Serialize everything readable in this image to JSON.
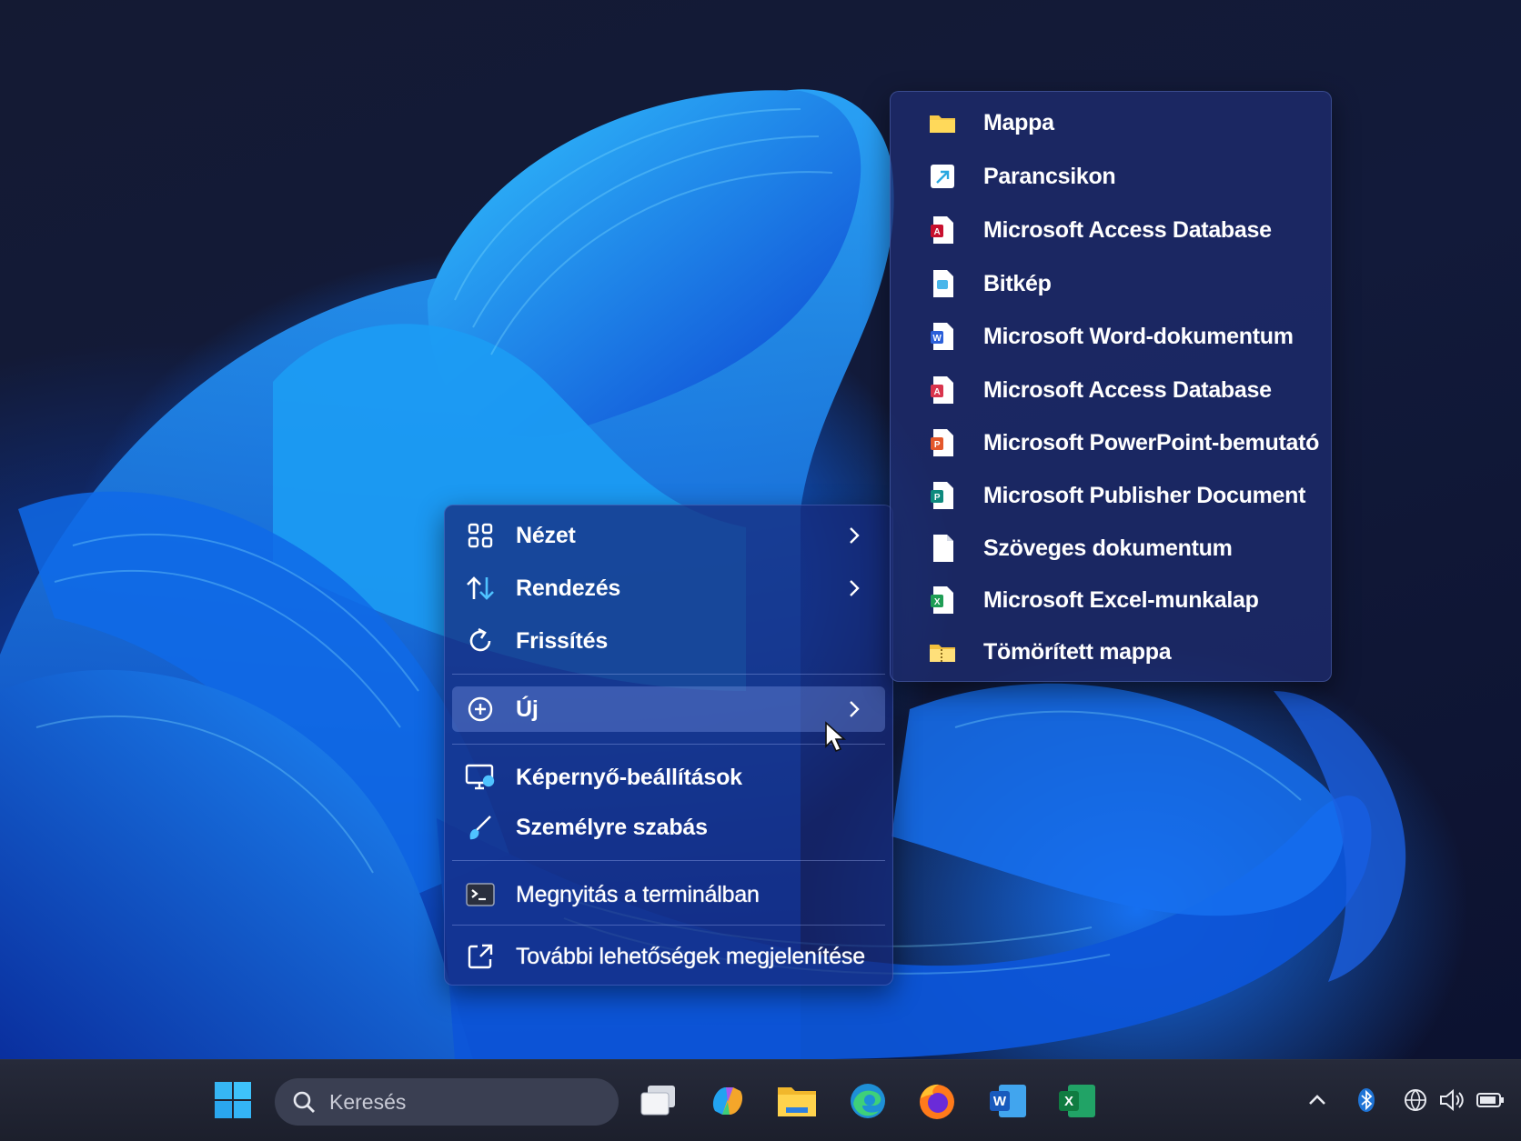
{
  "context_menu": {
    "items": [
      {
        "label": "Nézet",
        "icon": "grid-icon",
        "has_submenu": true
      },
      {
        "label": "Rendezés",
        "icon": "sort-arrows-icon",
        "has_submenu": true
      },
      {
        "label": "Frissítés",
        "icon": "refresh-icon",
        "has_submenu": false
      },
      {
        "label": "Új",
        "icon": "new-plus-icon",
        "has_submenu": true,
        "highlighted": true
      },
      {
        "label": "Képernyő-beállítások",
        "icon": "display-settings-icon"
      },
      {
        "label": "Személyre szabás",
        "icon": "brush-icon"
      },
      {
        "label": "Megnyitás a terminálban",
        "icon": "terminal-icon"
      },
      {
        "label": "További lehetőségek megjelenítése",
        "icon": "more-options-icon"
      }
    ]
  },
  "new_submenu": {
    "items": [
      {
        "label": "Mappa",
        "icon": "folder-icon"
      },
      {
        "label": "Parancsikon",
        "icon": "shortcut-icon"
      },
      {
        "label": "Microsoft Access Database",
        "icon": "access-file-icon"
      },
      {
        "label": "Bitkép",
        "icon": "bitmap-file-icon"
      },
      {
        "label": "Microsoft Word-dokumentum",
        "icon": "word-file-icon"
      },
      {
        "label": "Microsoft Access Database",
        "icon": "access-file-icon"
      },
      {
        "label": "Microsoft PowerPoint-bemutató",
        "icon": "powerpoint-file-icon"
      },
      {
        "label": "Microsoft Publisher Document",
        "icon": "publisher-file-icon"
      },
      {
        "label": "Szöveges dokumentum",
        "icon": "text-file-icon"
      },
      {
        "label": "Microsoft Excel-munkalap",
        "icon": "excel-file-icon"
      },
      {
        "label": "Tömörített mappa",
        "icon": "zip-folder-icon"
      }
    ]
  },
  "taskbar": {
    "search_placeholder": "Keresés",
    "apps": [
      "task-view-icon",
      "copilot-icon",
      "file-explorer-icon",
      "edge-icon",
      "firefox-icon",
      "word-icon",
      "excel-icon"
    ],
    "tray": [
      "chevron-up-icon",
      "bluetooth-icon",
      "network-icon",
      "volume-icon",
      "battery-icon"
    ]
  },
  "colors": {
    "menu_bg": "#16287a",
    "accent": "#3b82f6",
    "text": "#ffffff"
  }
}
